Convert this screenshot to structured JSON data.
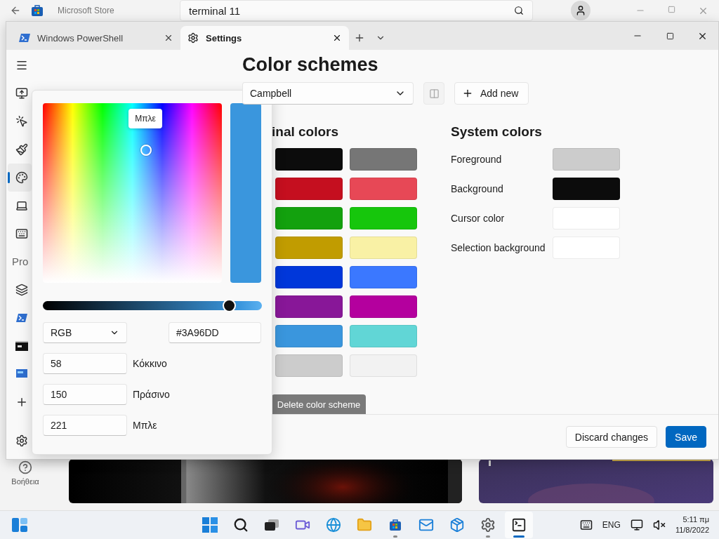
{
  "store": {
    "title": "Microsoft Store",
    "search": {
      "value": "terminal 11"
    },
    "help": "Βοήθεια"
  },
  "tabs": [
    {
      "label": "Windows PowerShell",
      "selected": false,
      "kind": "shell"
    },
    {
      "label": "Settings",
      "selected": true,
      "kind": "settings"
    }
  ],
  "sidebar": {
    "nav_items": [
      {
        "selected": false
      },
      {
        "selected": false
      },
      {
        "selected": false
      },
      {
        "selected": false
      },
      {
        "selected": true
      },
      {
        "selected": false
      },
      {
        "selected": false
      }
    ],
    "section_label": "Pro",
    "profile_items": [
      {
        "selected": false
      },
      {
        "selected": false
      },
      {
        "selected": false
      },
      {
        "selected": false
      }
    ]
  },
  "page": {
    "title": "Color schemes",
    "scheme": {
      "value": "Campbell"
    },
    "add_button": "Add new",
    "terminal_colors": {
      "title": "inal colors",
      "swatches": [
        {
          "color": "#0c0c0c"
        },
        {
          "color": "#767676"
        },
        {
          "color": "#c50f1f"
        },
        {
          "color": "#e74856"
        },
        {
          "color": "#13a10e"
        },
        {
          "color": "#16c60c"
        },
        {
          "color": "#c19c00"
        },
        {
          "color": "#f9f1a5"
        },
        {
          "color": "#0037da"
        },
        {
          "color": "#3b78ff"
        },
        {
          "color": "#881798"
        },
        {
          "color": "#b4009e"
        },
        {
          "color": "#3a96dd"
        },
        {
          "color": "#61d6d6"
        },
        {
          "color": "#cccccc"
        },
        {
          "color": "#f2f2f2"
        }
      ]
    },
    "delete_button": "Delete color scheme",
    "system_colors": {
      "title": "System colors",
      "rows": [
        {
          "label": "Foreground",
          "color": "#cccccc"
        },
        {
          "label": "Background",
          "color": "#0c0c0c"
        },
        {
          "label": "Cursor color",
          "color": "#ffffff"
        },
        {
          "label": "Selection background",
          "color": "#ffffff"
        }
      ]
    }
  },
  "footer": {
    "discard": "Discard changes",
    "save": "Save"
  },
  "picker": {
    "tooltip": "Μπλε",
    "level": 0.85,
    "mode": "RGB",
    "hex": "#3A96DD",
    "channels": [
      {
        "value": "58",
        "label": "Κόκκινο"
      },
      {
        "value": "150",
        "label": "Πράσινο"
      },
      {
        "value": "221",
        "label": "Μπλε"
      }
    ]
  },
  "taskbar": {
    "apps": [
      {
        "running": false,
        "selected": false
      },
      {
        "running": false,
        "selected": false
      },
      {
        "running": false,
        "selected": false
      },
      {
        "running": false,
        "selected": false
      },
      {
        "running": false,
        "selected": false
      },
      {
        "running": false,
        "selected": false
      },
      {
        "running": true,
        "selected": false
      },
      {
        "running": false,
        "selected": false
      },
      {
        "running": false,
        "selected": false
      },
      {
        "running": true,
        "selected": false
      },
      {
        "running": true,
        "selected": true
      }
    ],
    "language": "ENG",
    "time": "5:11 πμ",
    "date": "11/8/2022"
  }
}
